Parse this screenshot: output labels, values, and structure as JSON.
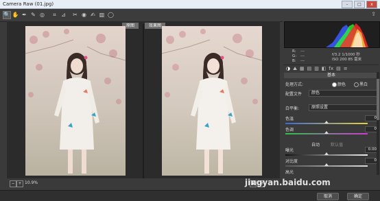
{
  "window": {
    "title": "Camera Raw (01.jpg)",
    "btn_min": "–",
    "btn_max": "□",
    "btn_close": "x"
  },
  "toolbar": {
    "tools": [
      {
        "name": "zoom-tool-icon",
        "glyph": "🔍",
        "active": true
      },
      {
        "name": "hand-tool-icon",
        "glyph": "✋"
      },
      {
        "name": "white-balance-tool-icon",
        "glyph": "✒"
      },
      {
        "name": "color-sampler-tool-icon",
        "glyph": "✎"
      },
      {
        "name": "targeted-adjustment-tool-icon",
        "glyph": "◎"
      },
      {
        "name": "crop-tool-icon",
        "glyph": "⌗"
      },
      {
        "name": "straighten-tool-icon",
        "glyph": "⊿"
      },
      {
        "name": "spot-removal-tool-icon",
        "glyph": "✂"
      },
      {
        "name": "red-eye-tool-icon",
        "glyph": "◉"
      },
      {
        "name": "adjustment-brush-icon",
        "glyph": "✍"
      },
      {
        "name": "graduated-filter-icon",
        "glyph": "▥"
      },
      {
        "name": "radial-filter-icon",
        "glyph": "◯"
      }
    ],
    "export_icon": "⇪"
  },
  "preview": {
    "before_label": "原图",
    "after_label": "效果图"
  },
  "statusbar": {
    "zoom_out": "−",
    "zoom_in": "+",
    "zoom_value": "10.9%",
    "view_mode": "▣",
    "swap": "⇄"
  },
  "histogram": {
    "colors": {
      "red": "#ff2a2a",
      "green": "#2aff2a",
      "blue": "#3a5cff",
      "yellow": "#ffd23a",
      "white": "#ffffff"
    }
  },
  "info": {
    "r_label": "R:",
    "g_label": "G:",
    "b_label": "B:",
    "r_value": "---",
    "g_value": "---",
    "b_value": "---",
    "exposure": "f/3.2  1/1000 秒",
    "iso": "ISO 200  85 毫米"
  },
  "panel_tabs": [
    "◑",
    "⛰",
    "▦",
    "▤",
    "▥",
    "◧",
    "fx",
    "▤",
    "≡"
  ],
  "basic": {
    "section_title": "基本",
    "treatment_label": "处理方式:",
    "treatment_color": "颜色",
    "treatment_bw": "黑白",
    "profile_label": "配置文件",
    "profile_value": "颜色",
    "wb_label": "白平衡:",
    "wb_value": "原照设置",
    "temp_label": "色温",
    "temp_value": "0",
    "tint_label": "色调",
    "tint_value": "0",
    "auto_label": "自动",
    "default_label": "默认值",
    "exposure_label": "曝光",
    "exposure_value": "0.00",
    "contrast_label": "对比度",
    "contrast_value": "0",
    "highlights_label": "高光"
  },
  "footer": {
    "cancel": "取消",
    "done": "确定"
  },
  "watermark": "jingyan.baidu.com"
}
